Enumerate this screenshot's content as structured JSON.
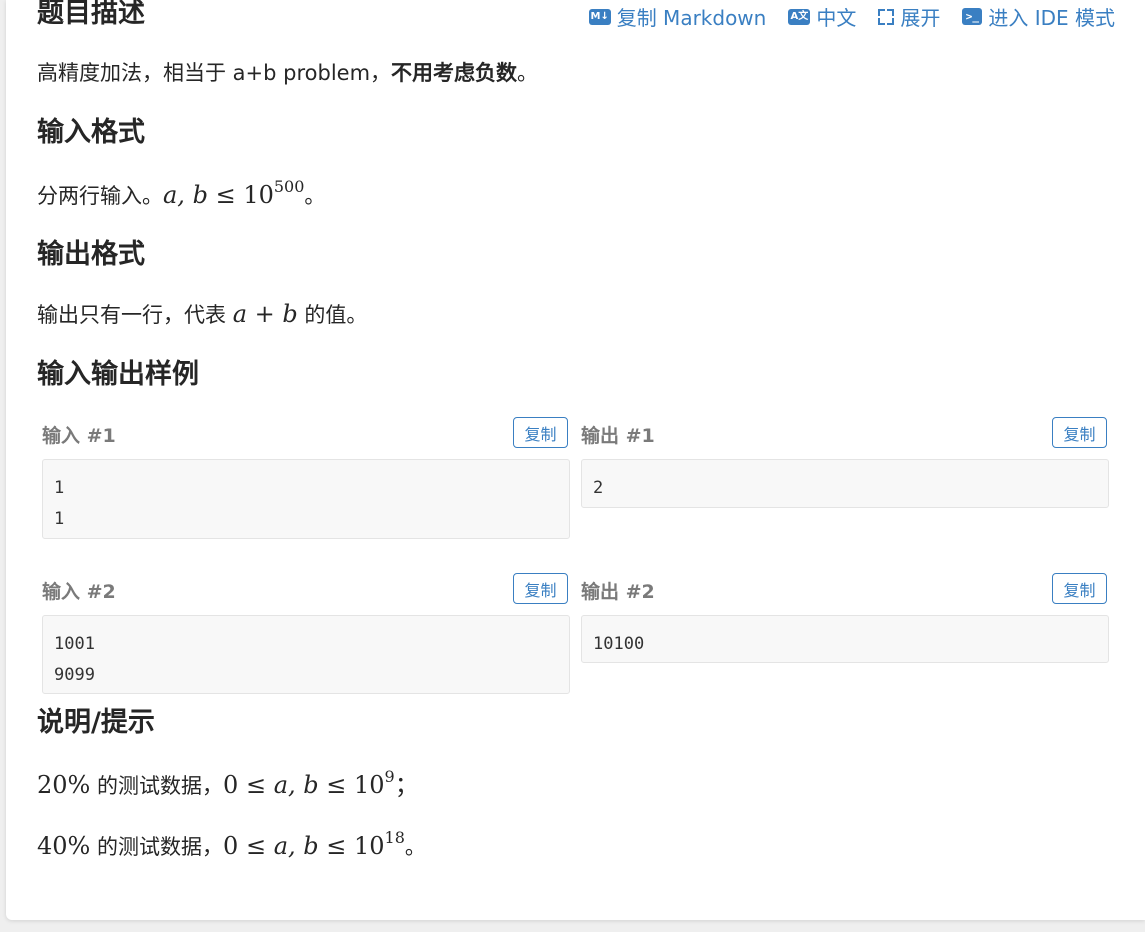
{
  "toolbar": {
    "copy_markdown": "复制 Markdown",
    "copy_markdown_icon": "M↓",
    "language": "中文",
    "language_icon": "A文",
    "expand": "展开",
    "ide": "进入 IDE 模式",
    "ide_icon": ">_",
    "accent_color": "#3a7fc2"
  },
  "description": {
    "title": "题目描述",
    "text_prefix": "高精度加法，相当于 a+b problem，",
    "text_bold": "不用考虑负数",
    "text_suffix": "。"
  },
  "input_format": {
    "title": "输入格式",
    "text_prefix": "分两行输入。",
    "math_ab": "a, b",
    "math_le": " ≤ ",
    "math_base": "10",
    "math_exp": "500",
    "text_suffix": "。"
  },
  "output_format": {
    "title": "输出格式",
    "text_prefix": "输出只有一行，代表 ",
    "math_a": "a",
    "math_plus": " + ",
    "math_b": "b",
    "text_suffix": " 的值。"
  },
  "samples": {
    "title": "输入输出样例",
    "copy_label": "复制",
    "items": [
      {
        "input_label": "输入 #1",
        "input": "1\n1",
        "output_label": "输出 #1",
        "output": "2"
      },
      {
        "input_label": "输入 #2",
        "input": "1001\n9099",
        "output_label": "输出 #2",
        "output": "10100"
      }
    ]
  },
  "hint": {
    "title": "说明/提示",
    "lines": [
      {
        "percent": "20%",
        "mid": " 的测试数据，",
        "zero": "0",
        "le1": " ≤ ",
        "ab": "a, b",
        "le2": " ≤ ",
        "base": "10",
        "exp": "9",
        "end": "；"
      },
      {
        "percent": "40%",
        "mid": " 的测试数据，",
        "zero": "0",
        "le1": " ≤ ",
        "ab": "a, b",
        "le2": " ≤ ",
        "base": "10",
        "exp": "18",
        "end": "。"
      }
    ]
  }
}
